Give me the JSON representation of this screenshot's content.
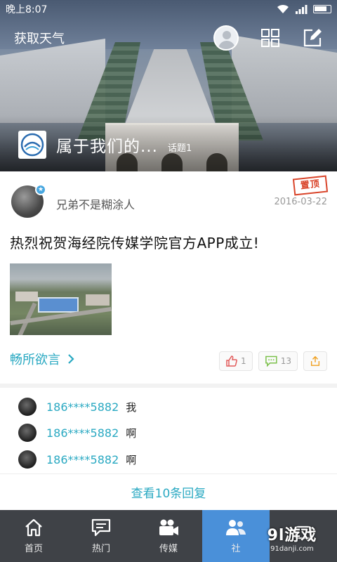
{
  "status_bar": {
    "time": "晚上8:07"
  },
  "header": {
    "weather_link": "获取天气",
    "circle_name": "属于我们的...",
    "topic_count": "话题1"
  },
  "post": {
    "author": "兄弟不是糊涂人",
    "pinned_label": "置顶",
    "date": "2016-03-22",
    "title": "热烈祝贺海经院传媒学院官方APP成立!",
    "circle_link": "畅所欲言",
    "likes": "1",
    "comments": "13"
  },
  "replies": [
    {
      "user": "186****5882",
      "text": "我"
    },
    {
      "user": "186****5882",
      "text": "啊"
    },
    {
      "user": "186****5882",
      "text": "啊"
    }
  ],
  "more_replies_label": "查看10条回复",
  "tabbar": {
    "items": [
      {
        "label": "首页",
        "icon": "home-icon"
      },
      {
        "label": "热门",
        "icon": "chat-icon"
      },
      {
        "label": "传媒",
        "icon": "video-camera-icon"
      },
      {
        "label": "社",
        "icon": "community-icon"
      },
      {
        "label": "",
        "icon": "message-icon"
      }
    ],
    "active_index": 3
  },
  "watermark": {
    "main": "9l游戏",
    "sub": "91danji.com"
  },
  "colors": {
    "accent": "#2aa9c2",
    "tab_active": "#4a90d9",
    "tab_bg": "#3f4247",
    "pin_red": "#d9452b"
  }
}
